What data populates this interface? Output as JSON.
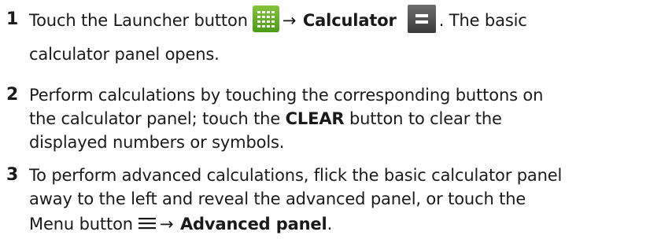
{
  "steps": [
    {
      "number": "1",
      "line1": {
        "text_a": "Touch the Launcher button",
        "arrow": "→",
        "bold_a": "Calculator",
        "text_b": ". The basic"
      },
      "line2": "calculator panel opens."
    },
    {
      "number": "2",
      "line1": "Perform calculations by touching the corresponding buttons on",
      "line2": {
        "text_a": "the calculator panel; touch the",
        "bold_a": "CLEAR",
        "text_b": "button to clear the"
      },
      "line3": "displayed numbers or symbols."
    },
    {
      "number": "3",
      "line1": "To perform advanced calculations, flick the basic calculator panel",
      "line2": "away to the left and reveal the advanced panel, or touch the",
      "line3": {
        "text_a": "Menu button",
        "arrow": "→",
        "bold_a": "Advanced panel",
        "text_b": "."
      }
    }
  ],
  "icons": {
    "launcher": "launcher-grid-icon",
    "calculator": "calculator-app-icon",
    "menu": "menu-icon"
  },
  "colors": {
    "launcher_icon": "#6bb52c",
    "calculator_icon": "#4a4a4a",
    "text": "#1a1a1a"
  }
}
